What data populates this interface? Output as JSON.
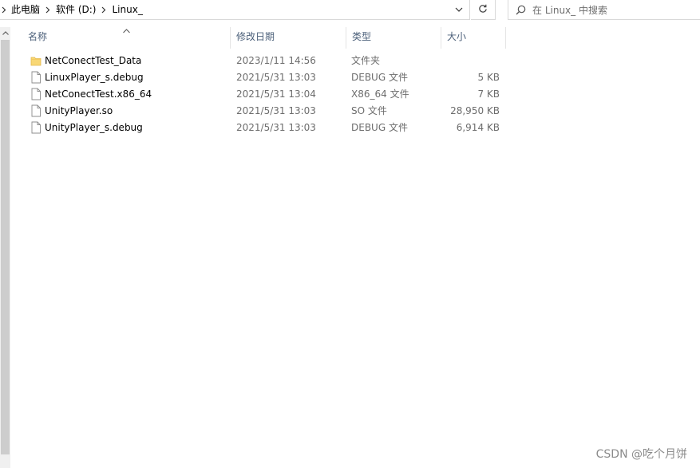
{
  "breadcrumb": {
    "items": [
      "此电脑",
      "软件 (D:)",
      "Linux_"
    ]
  },
  "search": {
    "placeholder": "在 Linux_ 中搜索"
  },
  "columns": {
    "name": "名称",
    "date": "修改日期",
    "type": "类型",
    "size": "大小"
  },
  "files": [
    {
      "name": "NetConectTest_Data",
      "date": "2023/1/11 14:56",
      "type": "文件夹",
      "size": "",
      "icon": "folder-icon"
    },
    {
      "name": "LinuxPlayer_s.debug",
      "date": "2021/5/31 13:03",
      "type": "DEBUG 文件",
      "size": "5 KB",
      "icon": "file-icon"
    },
    {
      "name": "NetConectTest.x86_64",
      "date": "2021/5/31 13:04",
      "type": "X86_64 文件",
      "size": "7 KB",
      "icon": "file-icon"
    },
    {
      "name": "UnityPlayer.so",
      "date": "2021/5/31 13:03",
      "type": "SO 文件",
      "size": "28,950 KB",
      "icon": "file-icon"
    },
    {
      "name": "UnityPlayer_s.debug",
      "date": "2021/5/31 13:03",
      "type": "DEBUG 文件",
      "size": "6,914 KB",
      "icon": "file-icon"
    }
  ],
  "watermark": "CSDN @吃个月饼",
  "colors": {
    "header_text": "#4c607a",
    "secondary_text": "#6d6d6d",
    "folder_yellow": "#f8d775"
  }
}
